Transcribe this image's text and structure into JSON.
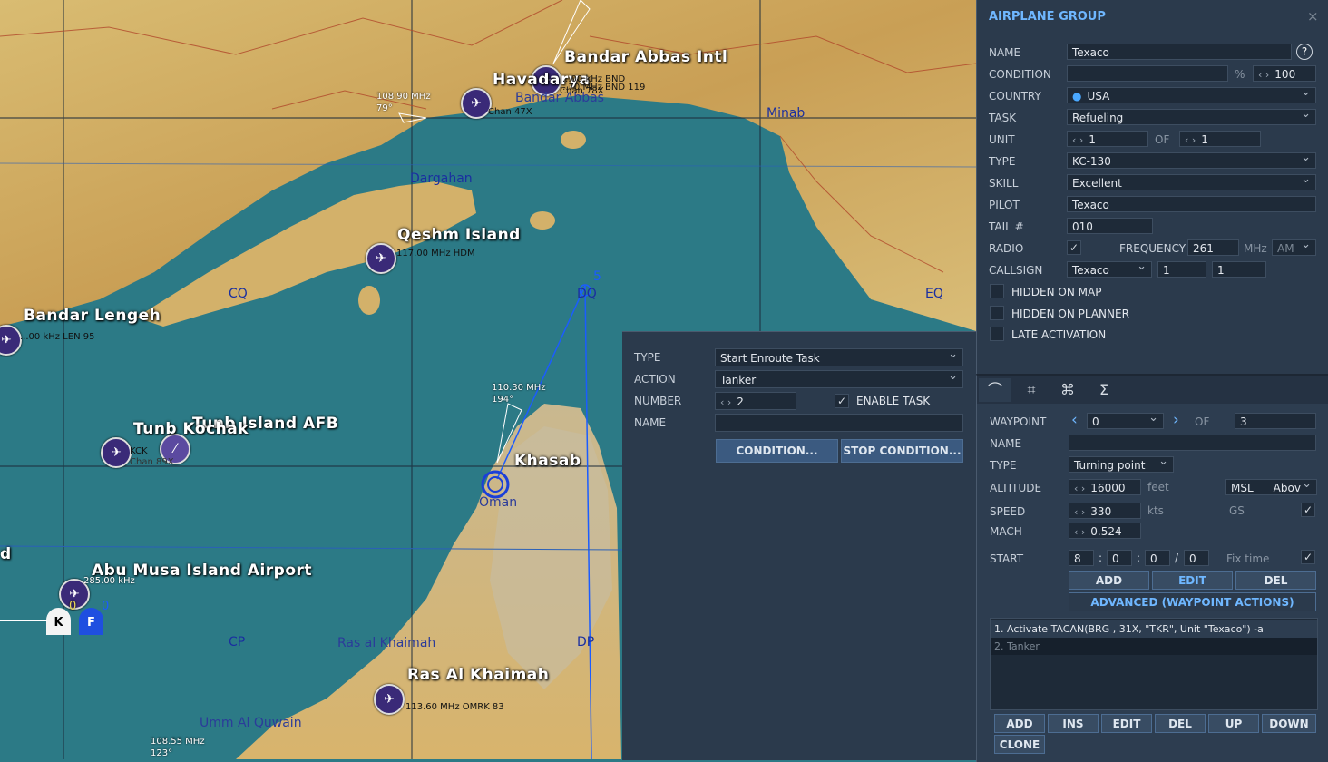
{
  "map": {
    "labels": {
      "bandar_abbas": "Bandar Abbas Intl",
      "havadarya": "Havadarya",
      "qeshm": "Qeshm Island",
      "bandar_lengeh": "Bandar Lengeh",
      "tunb_island": "Tunb Island AFB",
      "tunb_kochak": "Tunb Kochak",
      "khasab": "Khasab",
      "abu_musa": "Abu Musa Island Airport",
      "ras_al_khaimah": "Ras Al Khaimah",
      "edge_d": "d"
    },
    "place_labels": {
      "minab": "Minab",
      "dargahan": "Dargahan",
      "bandar_abbas_town": "Bandar Abbas",
      "ras_al_khaimah_town": "Ras al Khaimah",
      "umm_al_quwain": "Umm Al Quwain",
      "oman": "Oman"
    },
    "grid": {
      "cq": "CQ",
      "dq": "DQ",
      "eq": "EQ",
      "cp": "CP",
      "dp": "DP"
    },
    "info": {
      "bnd1": "...00 kHz BND",
      "bnd2": "...70 MHz BND 119",
      "bnd3": "Chan 78X",
      "hva": "Chan 47X",
      "lar": "108.90 MHz",
      "lar_deg": "79°",
      "qeshm_freq": "117.00 MHz HDM",
      "lengeh": "...00 kHz LEN 95",
      "kck": "KCK",
      "kck_chan": "Chan 89X",
      "khasab_ils": "110.30 MHz",
      "khasab_deg": "194°",
      "abu_musa": "285.00 kHz",
      "rak": "113.60 MHz OMRK 83",
      "bottom": "108.55 MHz",
      "bottom_deg": "123°",
      "wp_number": "5",
      "k_marker": "K",
      "f_marker": "F",
      "zero_a": "0",
      "zero_b": "0"
    }
  },
  "task_panel": {
    "type_label": "TYPE",
    "type_value": "Start Enroute Task",
    "action_label": "ACTION",
    "action_value": "Tanker",
    "number_label": "NUMBER",
    "number_value": "2",
    "enable_label": "ENABLE TASK",
    "name_label": "NAME",
    "name_value": "",
    "condition_btn": "CONDITION...",
    "stop_condition_btn": "STOP CONDITION..."
  },
  "group": {
    "title": "AIRPLANE GROUP",
    "close": "×",
    "name_label": "NAME",
    "name_value": "Texaco",
    "help": "?",
    "condition_label": "CONDITION",
    "condition_value": "",
    "percent": "%",
    "condition_pct": "100",
    "country_label": "COUNTRY",
    "country_value": "USA",
    "task_label": "TASK",
    "task_value": "Refueling",
    "unit_label": "UNIT",
    "unit_value": "1",
    "of": "OF",
    "unit_total": "1",
    "type_label": "TYPE",
    "type_value": "KC-130",
    "skill_label": "SKILL",
    "skill_value": "Excellent",
    "pilot_label": "PILOT",
    "pilot_value": "Texaco",
    "tail_label": "TAIL #",
    "tail_value": "010",
    "radio_label": "RADIO",
    "frequency_label": "FREQUENCY",
    "frequency_value": "261",
    "mhz": "MHz",
    "modulation": "AM",
    "callsign_label": "CALLSIGN",
    "callsign_value": "Texaco",
    "callsign_n1": "1",
    "callsign_n2": "1",
    "hidden_map": "HIDDEN ON MAP",
    "hidden_planner": "HIDDEN ON PLANNER",
    "late_activation": "LATE ACTIVATION"
  },
  "waypoint": {
    "tabs": [
      "route-icon",
      "payload-icon",
      "group-icon",
      "summary-icon"
    ],
    "waypoint_label": "WAYPOINT",
    "waypoint_value": "0",
    "of": "OF",
    "waypoint_total": "3",
    "name_label": "NAME",
    "name_value": "",
    "type_label": "TYPE",
    "type_value": "Turning point",
    "altitude_label": "ALTITUDE",
    "altitude_value": "16000",
    "feet": "feet",
    "msl": "MSL",
    "above": "Abov",
    "speed_label": "SPEED",
    "speed_value": "330",
    "kts": "kts",
    "gs": "GS",
    "mach_label": "MACH",
    "mach_value": "0.524",
    "start_label": "START",
    "start_h": "8",
    "start_m": "0",
    "start_s": "0",
    "start_d": "0",
    "colon": ":",
    "slash": "/",
    "fix_time": "Fix time",
    "add": "ADD",
    "edit": "EDIT",
    "del": "DEL",
    "advanced": "ADVANCED (WAYPOINT ACTIONS)",
    "actions": [
      "1. Activate TACAN(BRG , 31X, \"TKR\", Unit \"Texaco\")   -a",
      "2. Tanker"
    ],
    "btn_add": "ADD",
    "btn_ins": "INS",
    "btn_edit": "EDIT",
    "btn_del": "DEL",
    "btn_up": "UP",
    "btn_down": "DOWN",
    "btn_clone": "CLONE"
  },
  "colors": {
    "panel": "#2b3a4c",
    "sea": "#2c7a86",
    "land": "#d8b76a",
    "button": "#3b5a80",
    "accent": "#6fb7ff"
  }
}
